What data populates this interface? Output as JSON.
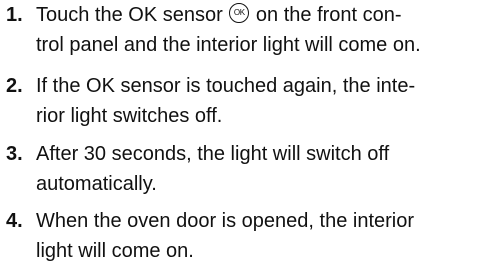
{
  "steps": [
    {
      "number": "1.",
      "line1_before": "Touch the OK sensor",
      "symbol": "OK",
      "line1_after": "on the front con-",
      "line2": "trol panel and the interior light will come on."
    },
    {
      "number": "2.",
      "line1": "If the OK sensor is touched again, the inte-",
      "line2": "rior light switches off."
    },
    {
      "number": "3.",
      "line1": "After 30 seconds, the light will switch off",
      "line2": "automatically."
    },
    {
      "number": "4.",
      "line1": "When the oven door is opened, the interior",
      "line2": "light will come on."
    }
  ]
}
